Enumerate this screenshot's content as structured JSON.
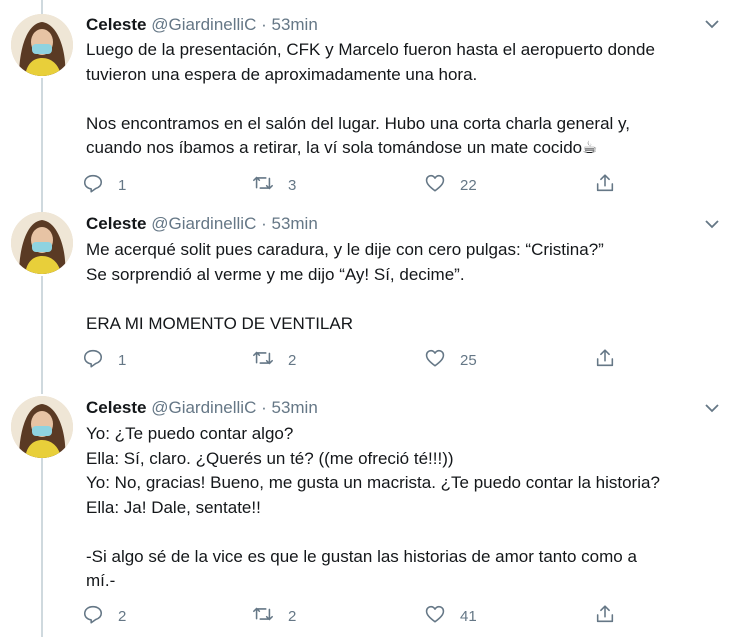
{
  "tweets": [
    {
      "name": "Celeste",
      "handle": "@GiardinelliC",
      "separator": "·",
      "time": "53min",
      "lines": [
        "Luego de la presentación, CFK y Marcelo fueron hasta el aeropuerto donde",
        "tuvieron una espera de aproximadamente una hora.",
        "",
        "Nos encontramos en el salón del lugar. Hubo una corta charla general y,",
        "cuando nos íbamos a retirar, la ví sola tomándose un mate cocido☕"
      ],
      "replies": "1",
      "retweets": "3",
      "likes": "22"
    },
    {
      "name": "Celeste",
      "handle": "@GiardinelliC",
      "separator": "·",
      "time": "53min",
      "lines": [
        "Me acerqué solit pues caradura, y le dije con cero pulgas: “Cristina?”",
        "Se sorprendió al verme y me dijo “Ay! Sí, decime”.",
        "",
        "ERA MI MOMENTO DE VENTILAR"
      ],
      "replies": "1",
      "retweets": "2",
      "likes": "25"
    },
    {
      "name": "Celeste",
      "handle": "@GiardinelliC",
      "separator": "·",
      "time": "53min",
      "lines": [
        "Yo: ¿Te puedo contar algo?",
        "Ella: Sí, claro. ¿Querés un té? ((me ofreció té!!!))",
        "Yo: No, gracias! Bueno, me gusta un macrista. ¿Te puedo contar la historia?",
        "Ella: Ja! Dale, sentate!!",
        "",
        "-Si algo sé de la vice es que le gustan las historias de amor tanto como a",
        "mí.-"
      ],
      "replies": "2",
      "retweets": "2",
      "likes": "41"
    }
  ],
  "icons": {
    "reply": "reply-icon",
    "retweet": "retweet-icon",
    "like": "heart-icon",
    "share": "share-icon",
    "caret": "chevron-down-icon"
  },
  "colors": {
    "text": "#14171a",
    "muted": "#657786",
    "thread_line": "#cfd9de",
    "icon": "#657786"
  }
}
